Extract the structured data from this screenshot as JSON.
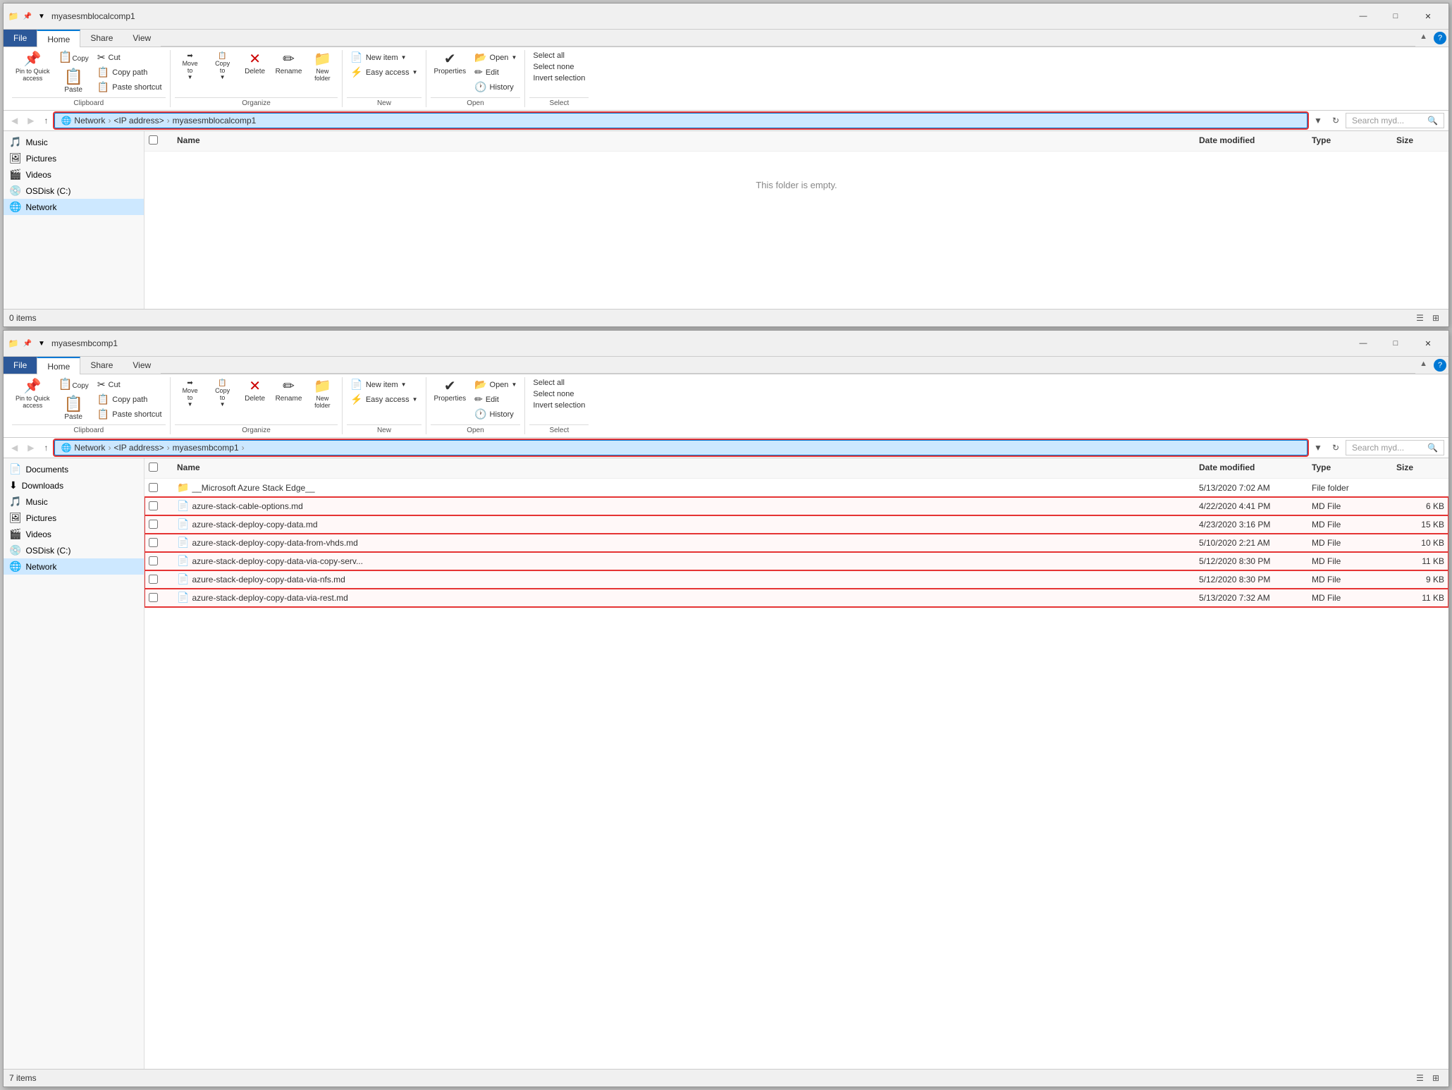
{
  "window1": {
    "title": "myasesmblocalcomp1",
    "tabFile": "File",
    "tabHome": "Home",
    "tabShare": "Share",
    "tabView": "View",
    "ribbon": {
      "clipboard": {
        "label": "Clipboard",
        "pinToQuickAccess": "Pin to Quick\naccess",
        "copy": "Copy",
        "paste": "Paste",
        "cut": "Cut",
        "copyPath": "Copy path",
        "pasteShortcut": "Paste shortcut"
      },
      "organize": {
        "label": "Organize",
        "moveTo": "Move\nto",
        "copyTo": "Copy\nto",
        "delete": "Delete",
        "rename": "Rename",
        "newFolder": "New\nfolder"
      },
      "new": {
        "label": "New",
        "newItem": "New item",
        "easyAccess": "Easy access"
      },
      "open": {
        "label": "Open",
        "properties": "Properties",
        "open": "Open",
        "edit": "Edit",
        "history": "History"
      },
      "select": {
        "label": "Select",
        "selectAll": "Select all",
        "selectNone": "Select none",
        "invertSelection": "Invert selection"
      }
    },
    "addressBar": {
      "path": "Network > <IP address> > myasesmblocalcomp1",
      "pathParts": [
        "Network",
        "<IP address>",
        "myasesmblocalcomp1"
      ],
      "searchPlaceholder": "Search myd..."
    },
    "sidebar": {
      "items": [
        {
          "label": "Music",
          "icon": "🎵"
        },
        {
          "label": "Pictures",
          "icon": "🖼"
        },
        {
          "label": "Videos",
          "icon": "🎬"
        },
        {
          "label": "OSDisk (C:)",
          "icon": "💿"
        },
        {
          "label": "Network",
          "icon": "🌐"
        }
      ]
    },
    "fileList": {
      "headers": [
        "",
        "Name",
        "Date modified",
        "Type",
        "Size"
      ],
      "empty": "This folder is empty.",
      "items": []
    },
    "statusBar": {
      "itemCount": "0 items"
    }
  },
  "window2": {
    "title": "myasesmbcomp1",
    "tabFile": "File",
    "tabHome": "Home",
    "tabShare": "Share",
    "tabView": "View",
    "ribbon": {
      "clipboard": {
        "label": "Clipboard",
        "pinToQuickAccess": "Pin to Quick\naccess",
        "copy": "Copy",
        "paste": "Paste",
        "cut": "Cut",
        "copyPath": "Copy path",
        "pasteShortcut": "Paste shortcut"
      },
      "organize": {
        "label": "Organize",
        "moveTo": "Move\nto",
        "copyTo": "Copy\nto",
        "delete": "Delete",
        "rename": "Rename",
        "newFolder": "New\nfolder"
      },
      "new": {
        "label": "New",
        "newItem": "New item",
        "easyAccess": "Easy access"
      },
      "open": {
        "label": "Open",
        "properties": "Properties",
        "open": "Open",
        "edit": "Edit",
        "history": "History"
      },
      "select": {
        "label": "Select",
        "selectAll": "Select all",
        "selectNone": "Select none",
        "invertSelection": "Invert selection"
      }
    },
    "addressBar": {
      "path": "Network > <IP address> > myasesmbcomp1 >",
      "pathParts": [
        "Network",
        "<IP address>",
        "myasesmbcomp1"
      ],
      "searchPlaceholder": "Search myd..."
    },
    "sidebar": {
      "items": [
        {
          "label": "Documents",
          "icon": "📄"
        },
        {
          "label": "Downloads",
          "icon": "⬇"
        },
        {
          "label": "Music",
          "icon": "🎵"
        },
        {
          "label": "Pictures",
          "icon": "🖼"
        },
        {
          "label": "Videos",
          "icon": "🎬"
        },
        {
          "label": "OSDisk (C:)",
          "icon": "💿"
        },
        {
          "label": "Network",
          "icon": "🌐"
        }
      ]
    },
    "fileList": {
      "headers": [
        "",
        "Name",
        "Date modified",
        "Type",
        "Size"
      ],
      "items": [
        {
          "icon": "📁",
          "name": "__Microsoft Azure Stack Edge__",
          "dateModified": "5/13/2020 7:02 AM",
          "type": "File folder",
          "size": "",
          "highlighted": false
        },
        {
          "icon": "📄",
          "name": "azure-stack-cable-options.md",
          "dateModified": "4/22/2020 4:41 PM",
          "type": "MD File",
          "size": "6 KB",
          "highlighted": true
        },
        {
          "icon": "📄",
          "name": "azure-stack-deploy-copy-data.md",
          "dateModified": "4/23/2020 3:16 PM",
          "type": "MD File",
          "size": "15 KB",
          "highlighted": true
        },
        {
          "icon": "📄",
          "name": "azure-stack-deploy-copy-data-from-vhds.md",
          "dateModified": "5/10/2020 2:21 AM",
          "type": "MD File",
          "size": "10 KB",
          "highlighted": true
        },
        {
          "icon": "📄",
          "name": "azure-stack-deploy-copy-data-via-copy-serv...",
          "dateModified": "5/12/2020 8:30 PM",
          "type": "MD File",
          "size": "11 KB",
          "highlighted": true
        },
        {
          "icon": "📄",
          "name": "azure-stack-deploy-copy-data-via-nfs.md",
          "dateModified": "5/12/2020 8:30 PM",
          "type": "MD File",
          "size": "9 KB",
          "highlighted": true
        },
        {
          "icon": "📄",
          "name": "azure-stack-deploy-copy-data-via-rest.md",
          "dateModified": "5/13/2020 7:32 AM",
          "type": "MD File",
          "size": "11 KB",
          "highlighted": true
        }
      ]
    },
    "statusBar": {
      "itemCount": "7 items"
    }
  }
}
